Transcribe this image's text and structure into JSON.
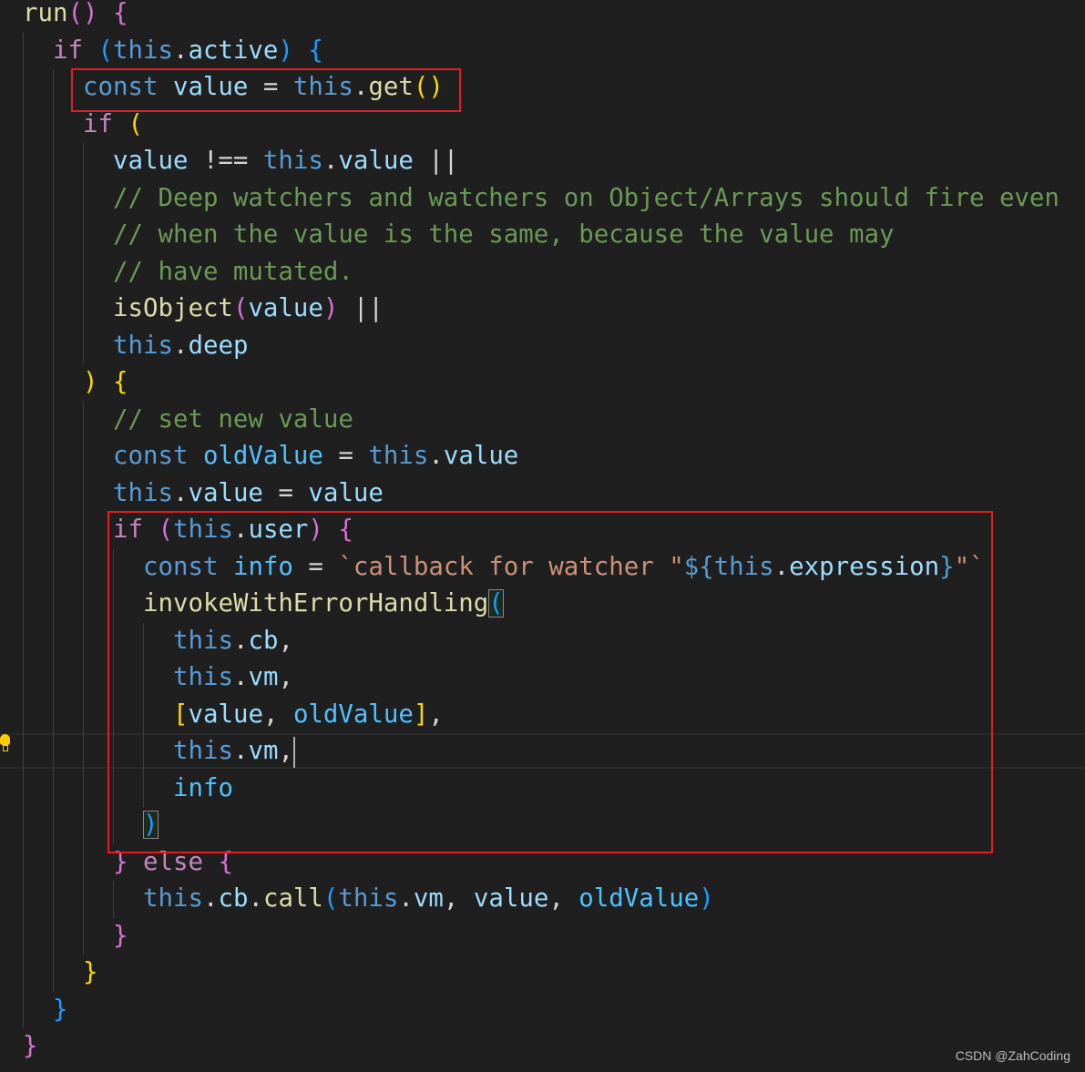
{
  "editor": {
    "theme_colors": {
      "background": "#1f1f1f",
      "keyword": "#569cd6",
      "variable": "#9cdcfe",
      "constant": "#4fc1ff",
      "function": "#dcdcaa",
      "control": "#c586c0",
      "string": "#ce9178",
      "comment": "#6a9955",
      "highlight_box": "#e51c23"
    },
    "cursor_line": 20,
    "lines": [
      {
        "indent": 0,
        "tokens": [
          [
            "run",
            "fn"
          ],
          [
            "()",
            "b2"
          ],
          [
            " ",
            "op"
          ],
          [
            "{",
            "b2"
          ]
        ]
      },
      {
        "indent": 1,
        "tokens": [
          [
            "if",
            "ctl"
          ],
          [
            " ",
            "op"
          ],
          [
            "(",
            "b3"
          ],
          [
            "this",
            "kw"
          ],
          [
            ".",
            "op"
          ],
          [
            "active",
            "var"
          ],
          [
            ")",
            "b3"
          ],
          [
            " ",
            "op"
          ],
          [
            "{",
            "b3"
          ]
        ]
      },
      {
        "indent": 2,
        "tokens": [
          [
            "const",
            "kw"
          ],
          [
            " ",
            "op"
          ],
          [
            "value",
            "var"
          ],
          [
            " = ",
            "op"
          ],
          [
            "this",
            "kw"
          ],
          [
            ".",
            "op"
          ],
          [
            "get",
            "fn"
          ],
          [
            "()",
            "b1"
          ]
        ]
      },
      {
        "indent": 2,
        "tokens": [
          [
            "if",
            "ctl"
          ],
          [
            " ",
            "op"
          ],
          [
            "(",
            "b1"
          ]
        ]
      },
      {
        "indent": 3,
        "tokens": [
          [
            "value",
            "var"
          ],
          [
            " !== ",
            "op"
          ],
          [
            "this",
            "kw"
          ],
          [
            ".",
            "op"
          ],
          [
            "value",
            "var"
          ],
          [
            " ||",
            "op"
          ]
        ]
      },
      {
        "indent": 3,
        "tokens": [
          [
            "// Deep watchers and watchers on Object/Arrays should fire even",
            "cm"
          ]
        ]
      },
      {
        "indent": 3,
        "tokens": [
          [
            "// when the value is the same, because the value may",
            "cm"
          ]
        ]
      },
      {
        "indent": 3,
        "tokens": [
          [
            "// have mutated.",
            "cm"
          ]
        ]
      },
      {
        "indent": 3,
        "tokens": [
          [
            "isObject",
            "fn"
          ],
          [
            "(",
            "b2"
          ],
          [
            "value",
            "var"
          ],
          [
            ")",
            "b2"
          ],
          [
            " ||",
            "op"
          ]
        ]
      },
      {
        "indent": 3,
        "tokens": [
          [
            "this",
            "kw"
          ],
          [
            ".",
            "op"
          ],
          [
            "deep",
            "var"
          ]
        ]
      },
      {
        "indent": 2,
        "tokens": [
          [
            ")",
            "b1"
          ],
          [
            " ",
            "op"
          ],
          [
            "{",
            "b1"
          ]
        ]
      },
      {
        "indent": 3,
        "tokens": [
          [
            "// set new value",
            "cm"
          ]
        ]
      },
      {
        "indent": 3,
        "tokens": [
          [
            "const",
            "kw"
          ],
          [
            " ",
            "op"
          ],
          [
            "oldValue",
            "const"
          ],
          [
            " = ",
            "op"
          ],
          [
            "this",
            "kw"
          ],
          [
            ".",
            "op"
          ],
          [
            "value",
            "var"
          ]
        ]
      },
      {
        "indent": 3,
        "tokens": [
          [
            "this",
            "kw"
          ],
          [
            ".",
            "op"
          ],
          [
            "value",
            "var"
          ],
          [
            " = ",
            "op"
          ],
          [
            "value",
            "var"
          ]
        ]
      },
      {
        "indent": 3,
        "tokens": [
          [
            "if",
            "ctl"
          ],
          [
            " ",
            "op"
          ],
          [
            "(",
            "b2"
          ],
          [
            "this",
            "kw"
          ],
          [
            ".",
            "op"
          ],
          [
            "user",
            "var"
          ],
          [
            ")",
            "b2"
          ],
          [
            " ",
            "op"
          ],
          [
            "{",
            "b2"
          ]
        ]
      },
      {
        "indent": 4,
        "tokens": [
          [
            "const",
            "kw"
          ],
          [
            " ",
            "op"
          ],
          [
            "info",
            "const"
          ],
          [
            " = ",
            "op"
          ],
          [
            "`callback for watcher \"",
            "str"
          ],
          [
            "${",
            "kw"
          ],
          [
            "this",
            "kw"
          ],
          [
            ".",
            "op"
          ],
          [
            "expression",
            "var"
          ],
          [
            "}",
            "kw"
          ],
          [
            "\"`",
            "str"
          ]
        ]
      },
      {
        "indent": 4,
        "tokens": [
          [
            "invokeWithErrorHandling",
            "fn"
          ],
          [
            "(",
            "b3 bm"
          ]
        ]
      },
      {
        "indent": 5,
        "tokens": [
          [
            "this",
            "kw"
          ],
          [
            ".",
            "op"
          ],
          [
            "cb",
            "var"
          ],
          [
            ",",
            "op"
          ]
        ]
      },
      {
        "indent": 5,
        "tokens": [
          [
            "this",
            "kw"
          ],
          [
            ".",
            "op"
          ],
          [
            "vm",
            "var"
          ],
          [
            ",",
            "op"
          ]
        ]
      },
      {
        "indent": 5,
        "tokens": [
          [
            "[",
            "b1"
          ],
          [
            "value",
            "var"
          ],
          [
            ", ",
            "op"
          ],
          [
            "oldValue",
            "const"
          ],
          [
            "]",
            "b1"
          ],
          [
            ",",
            "op"
          ]
        ]
      },
      {
        "indent": 5,
        "tokens": [
          [
            "this",
            "kw"
          ],
          [
            ".",
            "op"
          ],
          [
            "vm",
            "var"
          ],
          [
            ",",
            "op"
          ]
        ]
      },
      {
        "indent": 5,
        "tokens": [
          [
            "info",
            "const"
          ]
        ]
      },
      {
        "indent": 4,
        "tokens": [
          [
            ")",
            "b3 bm"
          ]
        ]
      },
      {
        "indent": 3,
        "tokens": [
          [
            "}",
            "b2"
          ],
          [
            " ",
            "op"
          ],
          [
            "else",
            "ctl"
          ],
          [
            " ",
            "op"
          ],
          [
            "{",
            "b2"
          ]
        ]
      },
      {
        "indent": 4,
        "tokens": [
          [
            "this",
            "kw"
          ],
          [
            ".",
            "op"
          ],
          [
            "cb",
            "var"
          ],
          [
            ".",
            "op"
          ],
          [
            "call",
            "fn"
          ],
          [
            "(",
            "b3"
          ],
          [
            "this",
            "kw"
          ],
          [
            ".",
            "op"
          ],
          [
            "vm",
            "var"
          ],
          [
            ", ",
            "op"
          ],
          [
            "value",
            "var"
          ],
          [
            ", ",
            "op"
          ],
          [
            "oldValue",
            "const"
          ],
          [
            ")",
            "b3"
          ]
        ]
      },
      {
        "indent": 3,
        "tokens": [
          [
            "}",
            "b2"
          ]
        ]
      },
      {
        "indent": 2,
        "tokens": [
          [
            "}",
            "b1"
          ]
        ]
      },
      {
        "indent": 1,
        "tokens": [
          [
            "}",
            "b3"
          ]
        ]
      },
      {
        "indent": 0,
        "tokens": [
          [
            "}",
            "b2"
          ]
        ]
      }
    ]
  },
  "watermark": "CSDN @ZahCoding"
}
